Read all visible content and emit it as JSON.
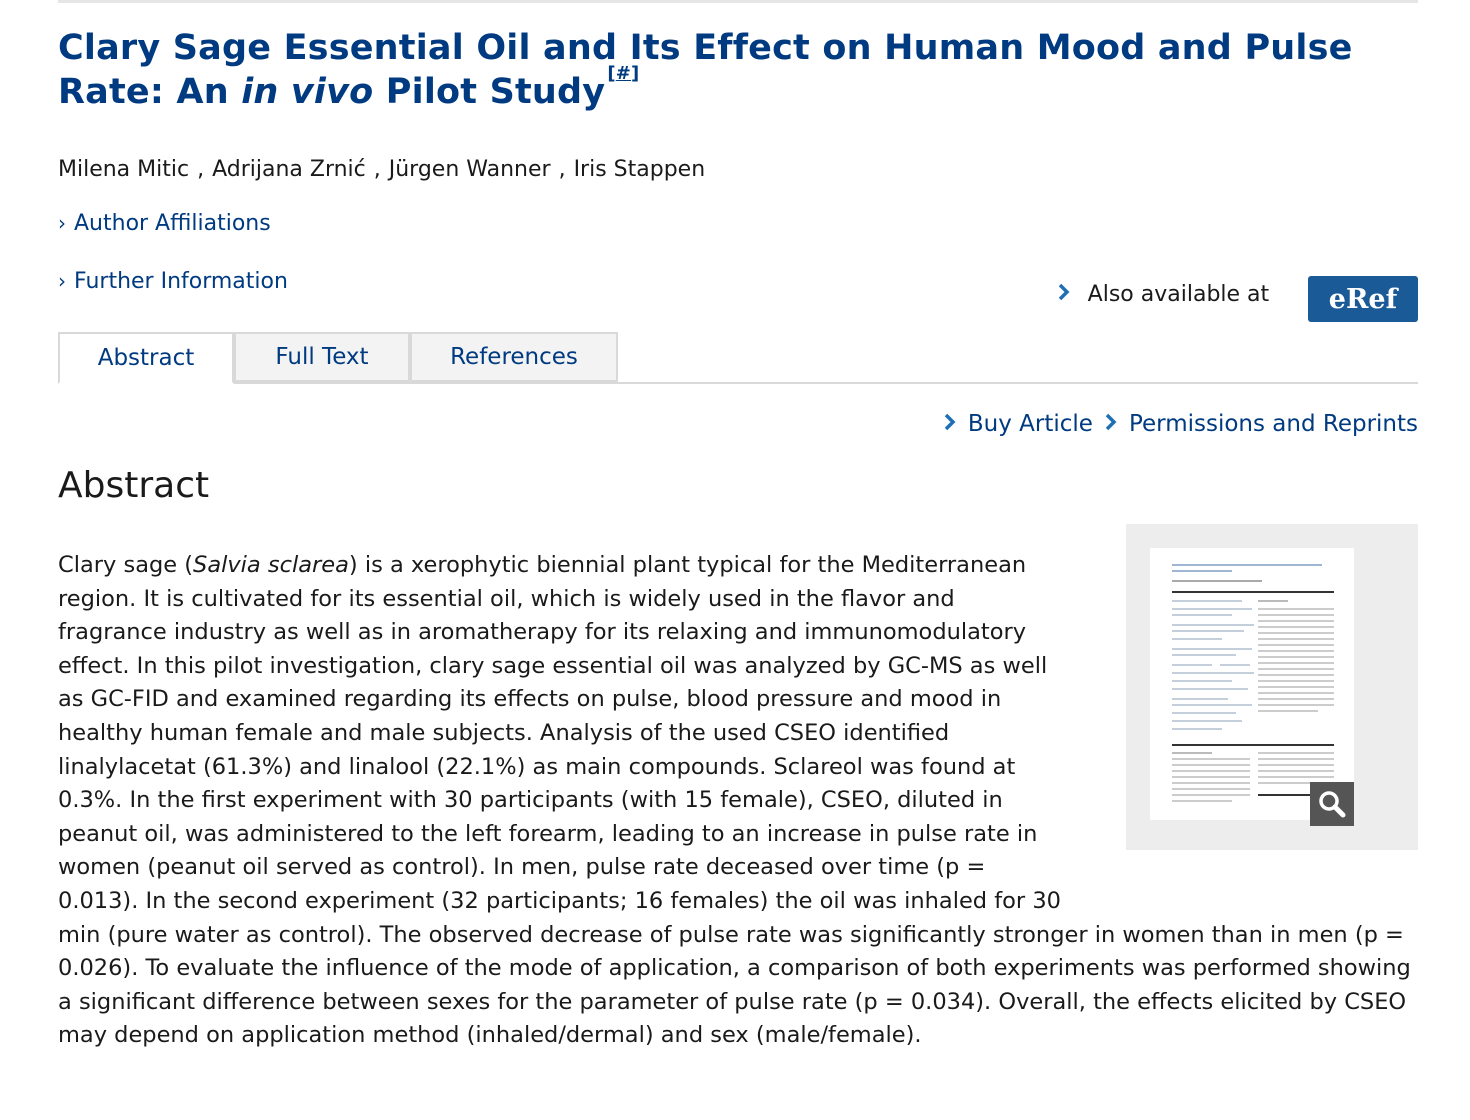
{
  "article": {
    "title_part1": "Clary Sage Essential Oil and Its Effect on Human Mood and Pulse Rate: An ",
    "title_italic": "in vivo",
    "title_part2": " Pilot Study",
    "title_note": "#",
    "authors": [
      "Milena Mitic",
      "Adrijana Zrnić",
      "Jürgen Wanner",
      "Iris Stappen"
    ],
    "author_separator": " , "
  },
  "links": {
    "affiliations": "Author Affiliations",
    "further_info": "Further Information",
    "chevron": "›"
  },
  "also_available": {
    "label": "Also available at",
    "badge": "eRef"
  },
  "tabs": [
    {
      "label": "Abstract",
      "active": true
    },
    {
      "label": "Full Text",
      "active": false
    },
    {
      "label": "References",
      "active": false
    }
  ],
  "actions": {
    "buy": "Buy Article",
    "permissions": "Permissions and Reprints"
  },
  "abstract": {
    "heading": "Abstract",
    "intro": "Clary sage (",
    "species": "Salvia sclarea",
    "body": ") is a xerophytic biennial plant typical for the Mediterranean region. It is cultivated for its essential oil, which is widely used in the flavor and fragrance industry as well as in aromatherapy for its relaxing and immunomodulatory effect. In this pilot investigation, clary sage essential oil was analyzed by GC-MS as well as GC-FID and examined regarding its effects on pulse, blood pressure and mood in healthy human female and male subjects. Analysis of the used CSEO identified linalylacetat (61.3%) and linalool (22.1%) as main compounds. Sclareol was found at 0.3%. In the first experiment with 30 participants (with 15 female), CSEO, diluted in peanut oil, was administered to the left forearm, leading to an increase in pulse rate in women (peanut oil served as control). In men, pulse rate deceased over time (p = 0.013). In the second experiment (32 participants; 16 females) the oil was inhaled for 30 min (pure water as control). The observed decrease of pulse rate was significantly stronger in women than in men (p = 0.026). To evaluate the influence of the mode of application, a comparison of both experiments was performed showing a significant difference between sexes for the parameter of pulse rate (p = 0.034). Overall, the effects elicited by CSEO may depend on application method (inhaled/dermal) and sex (male/female)."
  },
  "colors": {
    "brand_blue": "#003a80",
    "eref_bg": "#1a5a96",
    "chevron_blue": "#1f6fb5"
  }
}
